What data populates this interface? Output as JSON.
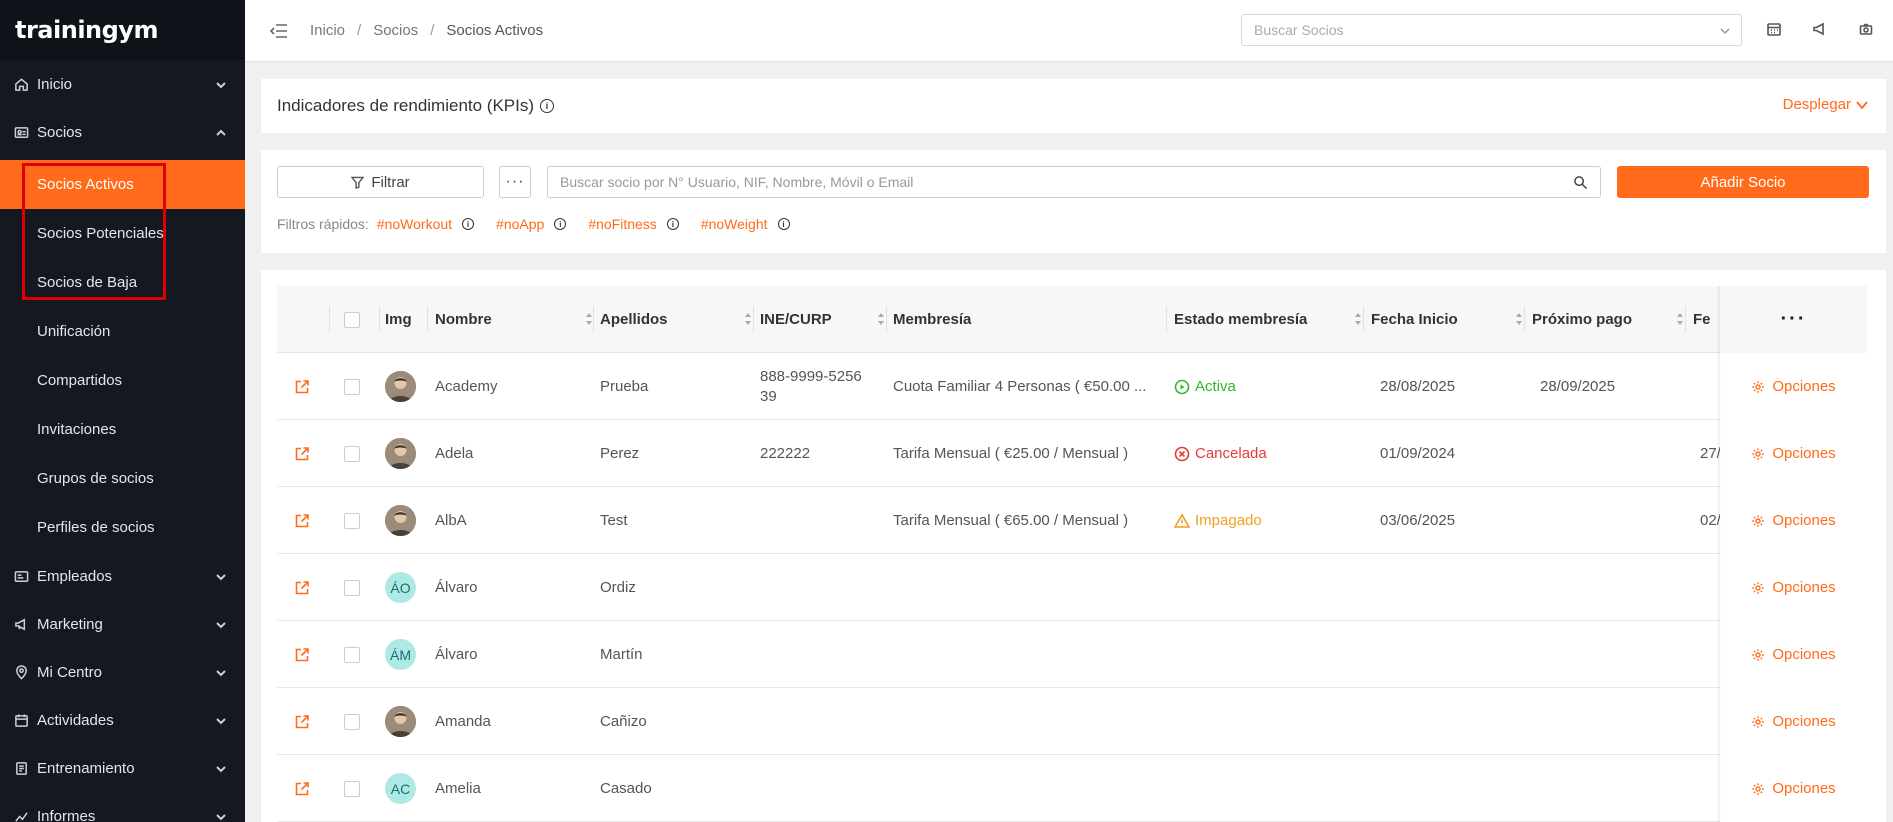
{
  "app": {
    "logo": "trainingym"
  },
  "sidebar": {
    "items": [
      {
        "label": "Inicio",
        "icon": "home-icon"
      },
      {
        "label": "Socios",
        "icon": "members-card-icon",
        "expanded": true
      }
    ],
    "socios_sub": [
      {
        "label": "Socios Activos",
        "active": true
      },
      {
        "label": "Socios Potenciales"
      },
      {
        "label": "Socios de Baja"
      },
      {
        "label": "Unificación"
      },
      {
        "label": "Compartidos"
      },
      {
        "label": "Invitaciones"
      },
      {
        "label": "Grupos de socios"
      },
      {
        "label": "Perfiles de socios"
      }
    ],
    "bottom_items": [
      {
        "label": "Empleados",
        "icon": "id-card-icon"
      },
      {
        "label": "Marketing",
        "icon": "megaphone-icon"
      },
      {
        "label": "Mi Centro",
        "icon": "location-pin-icon"
      },
      {
        "label": "Actividades",
        "icon": "calendar-icon"
      },
      {
        "label": "Entrenamiento",
        "icon": "clipboard-icon"
      },
      {
        "label": "Informes",
        "icon": "chart-icon"
      }
    ]
  },
  "topbar": {
    "breadcrumb": [
      "Inicio",
      "Socios",
      "Socios Activos"
    ],
    "search_placeholder": "Buscar Socios"
  },
  "kpi": {
    "title": "Indicadores de rendimiento (KPIs)",
    "toggle_label": "Desplegar"
  },
  "filters": {
    "filter_label": "Filtrar",
    "more_label": "···",
    "search_placeholder": "Buscar socio por N° Usuario, NIF, Nombre, Móvil o Email",
    "add_label": "Añadir Socio",
    "quick_label": "Filtros rápidos:",
    "quick_tags": [
      "#noWorkout",
      "#noApp",
      "#noFitness",
      "#noWeight"
    ]
  },
  "table": {
    "headers": {
      "img": "Img",
      "nombre": "Nombre",
      "apellidos": "Apellidos",
      "ine": "INE/CURP",
      "membresia": "Membresía",
      "estado": "Estado membresía",
      "fecha_inicio": "Fecha Inicio",
      "proximo_pago": "Próximo pago",
      "fe": "Fe",
      "more": "···"
    },
    "options_label": "Opciones",
    "rows": [
      {
        "avatar": "photo",
        "initials": "",
        "nombre": "Academy",
        "apellidos": "Prueba",
        "ine": "888-9999-525639",
        "membresia": "Cuota Familiar 4 Personas ( €50.00 ...",
        "estado": "Activa",
        "estado_type": "active",
        "fecha_inicio": "28/08/2025",
        "proximo_pago": "28/09/2025",
        "fe": ""
      },
      {
        "avatar": "photo",
        "initials": "",
        "nombre": "Adela",
        "apellidos": "Perez",
        "ine": "222222",
        "membresia": "Tarifa Mensual ( €25.00 / Mensual )",
        "estado": "Cancelada",
        "estado_type": "cancelled",
        "fecha_inicio": "01/09/2024",
        "proximo_pago": "",
        "fe": "27/"
      },
      {
        "avatar": "photo",
        "initials": "",
        "nombre": "AlbA",
        "apellidos": "Test",
        "ine": "",
        "membresia": "Tarifa Mensual ( €65.00 / Mensual )",
        "estado": "Impagado",
        "estado_type": "unpaid",
        "fecha_inicio": "03/06/2025",
        "proximo_pago": "",
        "fe": "02/"
      },
      {
        "avatar": "initials",
        "initials": "ÁO",
        "nombre": "Álvaro",
        "apellidos": "Ordiz",
        "ine": "",
        "membresia": "",
        "estado": "",
        "estado_type": "",
        "fecha_inicio": "",
        "proximo_pago": "",
        "fe": ""
      },
      {
        "avatar": "initials",
        "initials": "ÁM",
        "nombre": "Álvaro",
        "apellidos": "Martín",
        "ine": "",
        "membresia": "",
        "estado": "",
        "estado_type": "",
        "fecha_inicio": "",
        "proximo_pago": "",
        "fe": ""
      },
      {
        "avatar": "photo",
        "initials": "",
        "nombre": "Amanda",
        "apellidos": "Cañizo",
        "ine": "",
        "membresia": "",
        "estado": "",
        "estado_type": "",
        "fecha_inicio": "",
        "proximo_pago": "",
        "fe": ""
      },
      {
        "avatar": "initials",
        "initials": "AC",
        "nombre": "Amelia",
        "apellidos": "Casado",
        "ine": "",
        "membresia": "",
        "estado": "",
        "estado_type": "",
        "fecha_inicio": "",
        "proximo_pago": "",
        "fe": ""
      }
    ]
  },
  "colors": {
    "accent": "#ff6b1a",
    "sidebar_bg": "#141821",
    "active": "#2eb82e",
    "cancelled": "#e53935",
    "unpaid": "#f0a020"
  }
}
